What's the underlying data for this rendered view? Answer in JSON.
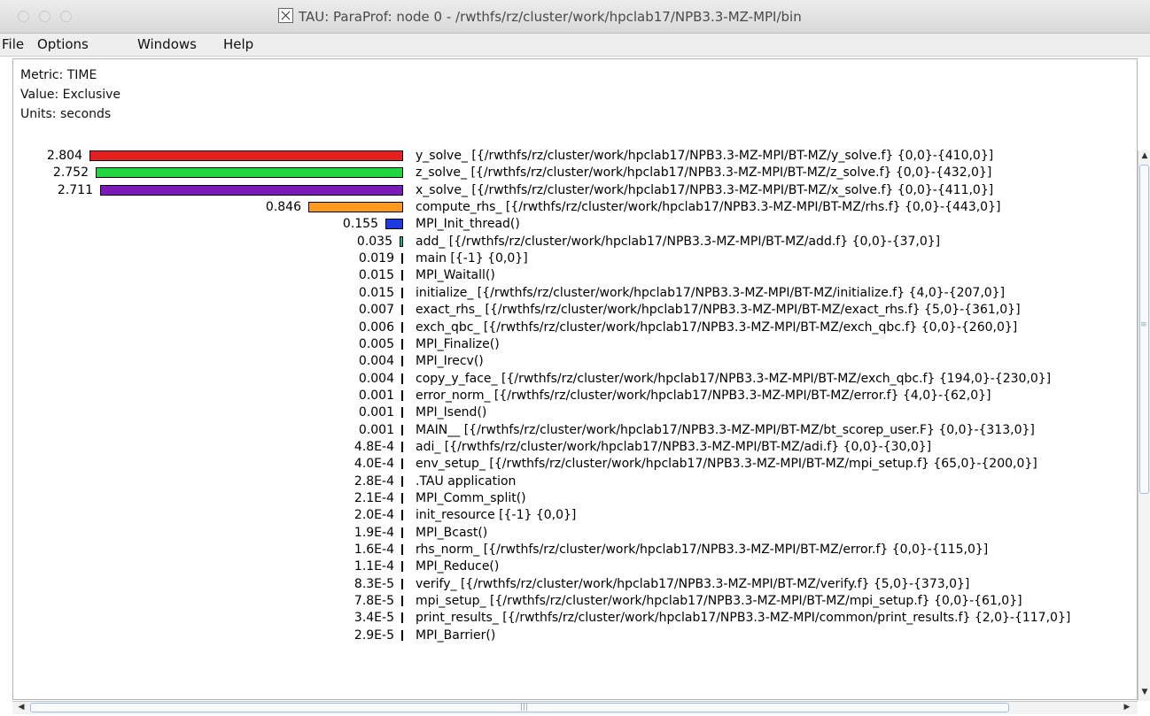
{
  "window": {
    "title": "TAU: ParaProf: node 0 - /rwthfs/rz/cluster/work/hpclab17/NPB3.3-MZ-MPI/bin"
  },
  "menu": [
    "File",
    "Options",
    "Windows",
    "Help"
  ],
  "info": {
    "metric": "Metric: TIME",
    "value": "Value: Exclusive",
    "units": "Units: seconds"
  },
  "chart_data": {
    "type": "bar",
    "orientation": "horizontal",
    "metric": "TIME",
    "value_type": "Exclusive",
    "units": "seconds",
    "rows": [
      {
        "value": "2.804",
        "label": "y_solve_ [{/rwthfs/rz/cluster/work/hpclab17/NPB3.3-MZ-MPI/BT-MZ/y_solve.f} {0,0}-{410,0}]",
        "color": "#e81f1f"
      },
      {
        "value": "2.752",
        "label": "z_solve_ [{/rwthfs/rz/cluster/work/hpclab17/NPB3.3-MZ-MPI/BT-MZ/z_solve.f} {0,0}-{432,0}]",
        "color": "#22d640"
      },
      {
        "value": "2.711",
        "label": "x_solve_ [{/rwthfs/rz/cluster/work/hpclab17/NPB3.3-MZ-MPI/BT-MZ/x_solve.f} {0,0}-{411,0}]",
        "color": "#7a18b8"
      },
      {
        "value": "0.846",
        "label": "compute_rhs_ [{/rwthfs/rz/cluster/work/hpclab17/NPB3.3-MZ-MPI/BT-MZ/rhs.f} {0,0}-{443,0}]",
        "color": "#ff9a1f"
      },
      {
        "value": "0.155",
        "label": "MPI_Init_thread()",
        "color": "#1b3be0"
      },
      {
        "value": "0.035",
        "label": "add_ [{/rwthfs/rz/cluster/work/hpclab17/NPB3.3-MZ-MPI/BT-MZ/add.f} {0,0}-{37,0}]",
        "color": "#1fb58a"
      },
      {
        "value": "0.019",
        "label": "main [{-1} {0,0}]",
        "color": "#999999"
      },
      {
        "value": "0.015",
        "label": "MPI_Waitall()",
        "color": "#999999"
      },
      {
        "value": "0.015",
        "label": "initialize_ [{/rwthfs/rz/cluster/work/hpclab17/NPB3.3-MZ-MPI/BT-MZ/initialize.f} {4,0}-{207,0}]",
        "color": "#999999"
      },
      {
        "value": "0.007",
        "label": "exact_rhs_ [{/rwthfs/rz/cluster/work/hpclab17/NPB3.3-MZ-MPI/BT-MZ/exact_rhs.f} {5,0}-{361,0}]",
        "color": "#999999"
      },
      {
        "value": "0.006",
        "label": "exch_qbc_ [{/rwthfs/rz/cluster/work/hpclab17/NPB3.3-MZ-MPI/BT-MZ/exch_qbc.f} {0,0}-{260,0}]",
        "color": "#999999"
      },
      {
        "value": "0.005",
        "label": "MPI_Finalize()",
        "color": "#999999"
      },
      {
        "value": "0.004",
        "label": "MPI_Irecv()",
        "color": "#999999"
      },
      {
        "value": "0.004",
        "label": "copy_y_face_ [{/rwthfs/rz/cluster/work/hpclab17/NPB3.3-MZ-MPI/BT-MZ/exch_qbc.f} {194,0}-{230,0}]",
        "color": "#999999"
      },
      {
        "value": "0.001",
        "label": "error_norm_ [{/rwthfs/rz/cluster/work/hpclab17/NPB3.3-MZ-MPI/BT-MZ/error.f} {4,0}-{62,0}]",
        "color": "#999999"
      },
      {
        "value": "0.001",
        "label": "MPI_Isend()",
        "color": "#999999"
      },
      {
        "value": "0.001",
        "label": "MAIN__ [{/rwthfs/rz/cluster/work/hpclab17/NPB3.3-MZ-MPI/BT-MZ/bt_scorep_user.F} {0,0}-{313,0}]",
        "color": "#999999"
      },
      {
        "value": "4.8E-4",
        "label": "adi_ [{/rwthfs/rz/cluster/work/hpclab17/NPB3.3-MZ-MPI/BT-MZ/adi.f} {0,0}-{30,0}]",
        "color": "#999999"
      },
      {
        "value": "4.0E-4",
        "label": "env_setup_ [{/rwthfs/rz/cluster/work/hpclab17/NPB3.3-MZ-MPI/BT-MZ/mpi_setup.f} {65,0}-{200,0}]",
        "color": "#999999"
      },
      {
        "value": "2.8E-4",
        "label": ".TAU application",
        "color": "#999999"
      },
      {
        "value": "2.1E-4",
        "label": "MPI_Comm_split()",
        "color": "#999999"
      },
      {
        "value": "2.0E-4",
        "label": "init_resource [{-1} {0,0}]",
        "color": "#999999"
      },
      {
        "value": "1.9E-4",
        "label": "MPI_Bcast()",
        "color": "#999999"
      },
      {
        "value": "1.6E-4",
        "label": "rhs_norm_ [{/rwthfs/rz/cluster/work/hpclab17/NPB3.3-MZ-MPI/BT-MZ/error.f} {0,0}-{115,0}]",
        "color": "#999999"
      },
      {
        "value": "1.1E-4",
        "label": "MPI_Reduce()",
        "color": "#999999"
      },
      {
        "value": "8.3E-5",
        "label": "verify_ [{/rwthfs/rz/cluster/work/hpclab17/NPB3.3-MZ-MPI/BT-MZ/verify.f} {5,0}-{373,0}]",
        "color": "#999999"
      },
      {
        "value": "7.8E-5",
        "label": "mpi_setup_ [{/rwthfs/rz/cluster/work/hpclab17/NPB3.3-MZ-MPI/BT-MZ/mpi_setup.f} {0,0}-{61,0}]",
        "color": "#999999"
      },
      {
        "value": "3.4E-5",
        "label": "print_results_ [{/rwthfs/rz/cluster/work/hpclab17/NPB3.3-MZ-MPI/common/print_results.f} {2,0}-{117,0}]",
        "color": "#999999"
      },
      {
        "value": "2.9E-5",
        "label": "MPI_Barrier()",
        "color": "#999999"
      }
    ]
  }
}
